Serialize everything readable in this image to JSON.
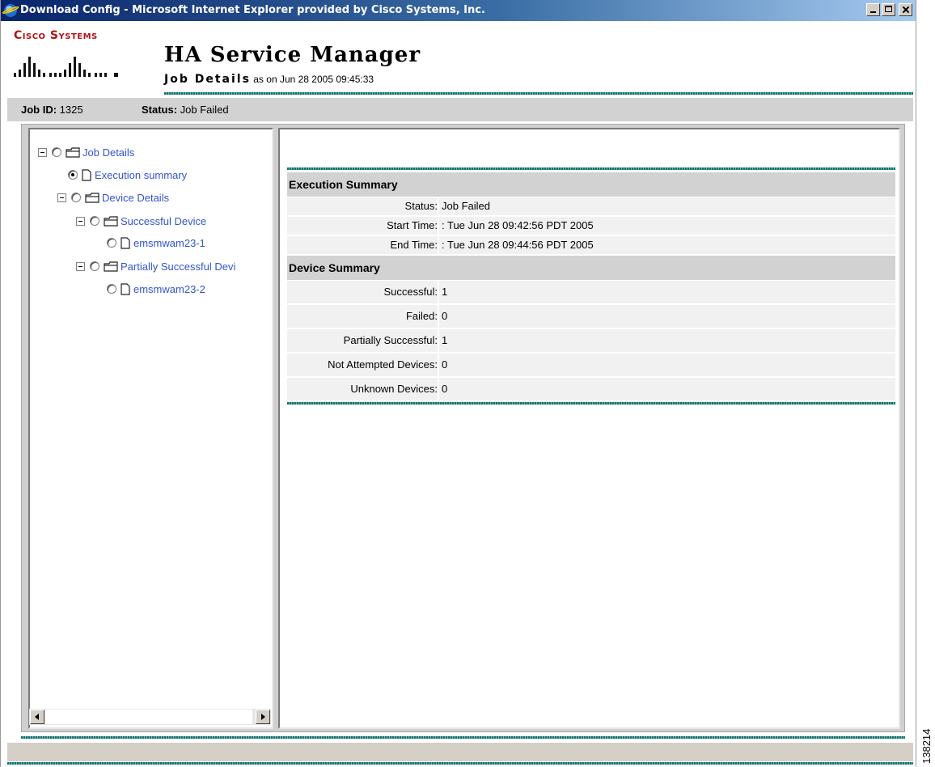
{
  "window": {
    "title": "Download Config - Microsoft Internet Explorer provided by Cisco Systems, Inc."
  },
  "header": {
    "logo_text": "Cisco Systems",
    "app_title": "HA Service Manager",
    "subtitle_strong": "Job Details",
    "subtitle_rest": " as on Jun 28 2005 09:45:33"
  },
  "job_bar": {
    "job_id_label": "Job ID:",
    "job_id_value": " 1325",
    "status_label": "Status:",
    "status_value": " Job Failed"
  },
  "tree": {
    "items": [
      {
        "label": "Job Details",
        "icon": "folder-icon",
        "checked": false,
        "expandable": true
      },
      {
        "label": "Execution summary",
        "icon": "document-icon",
        "checked": true,
        "expandable": false
      },
      {
        "label": "Device Details",
        "icon": "folder-icon",
        "checked": false,
        "expandable": true
      },
      {
        "label": "Successful Device",
        "icon": "folder-icon",
        "checked": false,
        "expandable": true
      },
      {
        "label": "emsmwam23-1",
        "icon": "document-icon",
        "checked": false,
        "expandable": false
      },
      {
        "label": "Partially Successful Devi",
        "icon": "folder-icon",
        "checked": false,
        "expandable": true
      },
      {
        "label": "emsmwam23-2",
        "icon": "document-icon",
        "checked": false,
        "expandable": false
      }
    ]
  },
  "execution_summary": {
    "heading": "Execution Summary",
    "rows": [
      {
        "label": "Status:",
        "value": "Job Failed"
      },
      {
        "label": "Start Time:",
        "value": ": Tue Jun 28 09:42:56 PDT 2005"
      },
      {
        "label": "End Time:",
        "value": ": Tue Jun 28 09:44:56 PDT 2005"
      }
    ]
  },
  "device_summary": {
    "heading": "Device Summary",
    "rows": [
      {
        "label": "Successful:",
        "value": "1"
      },
      {
        "label": "Failed:",
        "value": "0"
      },
      {
        "label": "Partially Successful:",
        "value": "1"
      },
      {
        "label": "Not Attempted Devices:",
        "value": "0"
      },
      {
        "label": "Unknown Devices:",
        "value": "0"
      }
    ]
  },
  "figure_number": "138214",
  "colors": {
    "accent_teal": "#0e6f6d",
    "logo_red": "#b0131a",
    "link_blue": "#3355cc",
    "section_gray": "#d2d2d2"
  }
}
